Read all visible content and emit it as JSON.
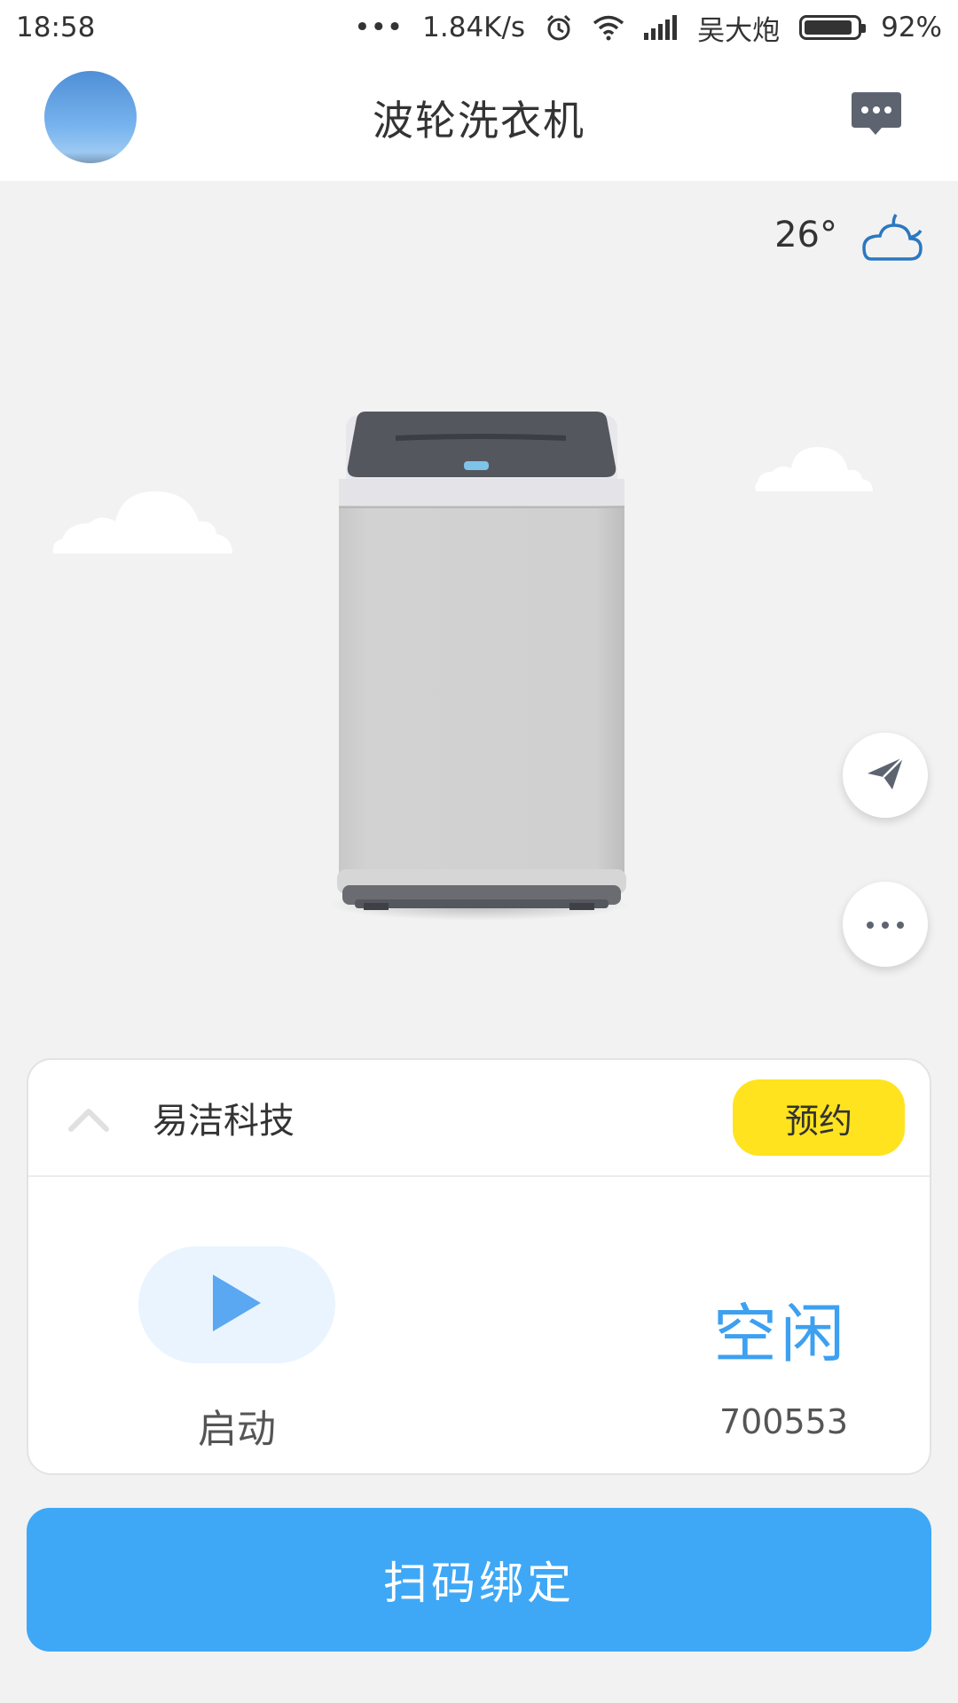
{
  "status_bar": {
    "time": "18:58",
    "dots": "•••",
    "network_speed": "1.84K/s",
    "carrier": "吴大炮",
    "battery": "92%",
    "battery_level": 0.92
  },
  "header": {
    "title": "波轮洗衣机",
    "avatar_icon": "avatar",
    "message_icon": "chat-bubble-icon"
  },
  "weather": {
    "temperature": "26°",
    "icon": "cloudy-night-icon"
  },
  "device": {
    "image": "top-load-washing-machine"
  },
  "actions": {
    "send_icon": "paper-plane-icon",
    "more_icon": "more-dots-icon"
  },
  "card": {
    "collapse_icon": "chevron-up-icon",
    "vendor": "易洁科技",
    "reserve_label": "预约",
    "start_icon": "play-icon",
    "start_label": "启动",
    "status": "空闲",
    "device_id": "700553"
  },
  "bind_button": {
    "label": "扫码绑定"
  },
  "colors": {
    "accent_blue": "#3ea8f7",
    "reserve_yellow": "#ffe31f",
    "status_blue": "#3da0f0",
    "background": "#f2f2f2"
  }
}
